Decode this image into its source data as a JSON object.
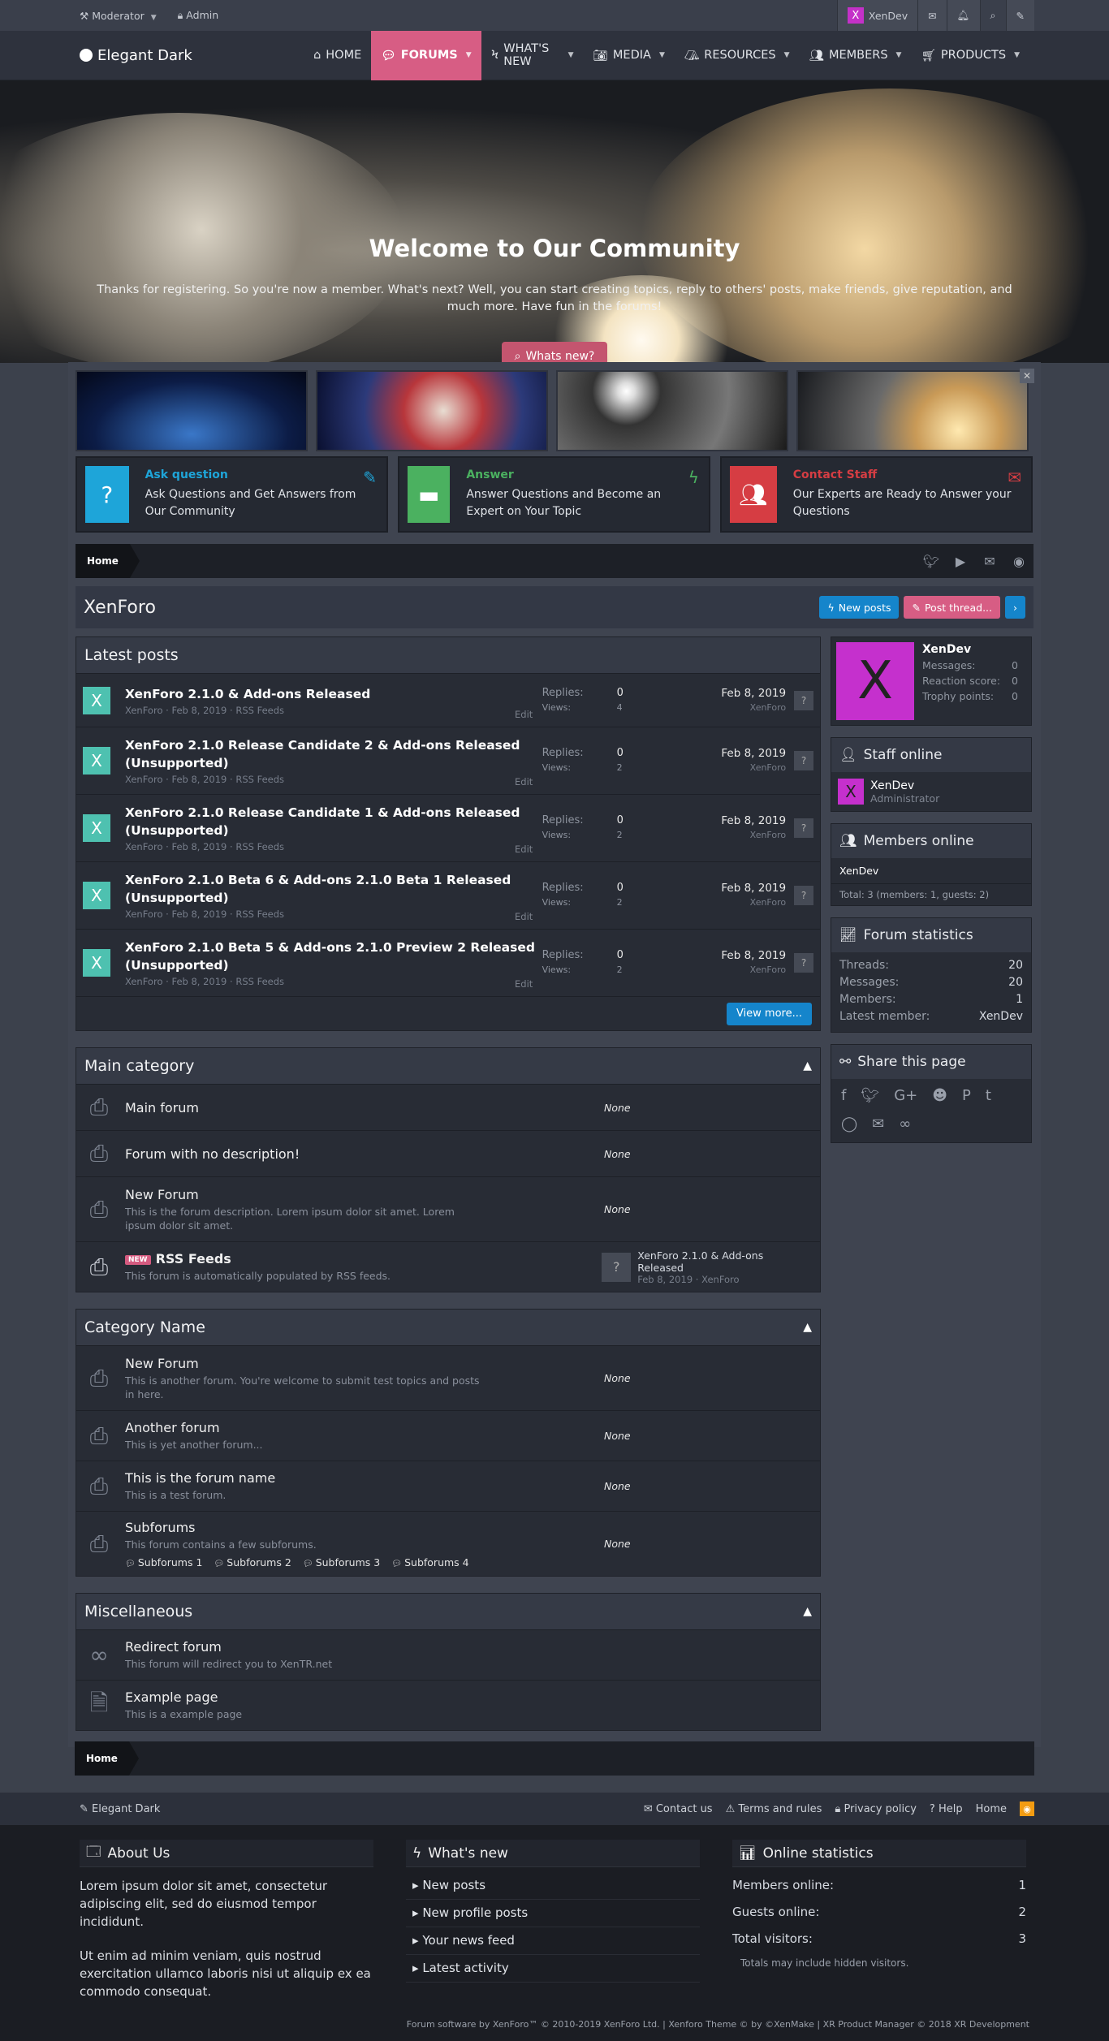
{
  "staffbar": {
    "moderator": "Moderator",
    "admin": "Admin",
    "user": "XenDev",
    "avatar_letter": "X"
  },
  "nav": {
    "logo": "Elegant Dark",
    "tabs": [
      {
        "label": "HOME",
        "icon": "home-icon",
        "caret": false
      },
      {
        "label": "FORUMS",
        "icon": "chat-icon",
        "caret": true
      },
      {
        "label": "WHAT'S NEW",
        "icon": "bolt-icon",
        "caret": true
      },
      {
        "label": "MEDIA",
        "icon": "camera-icon",
        "caret": true
      },
      {
        "label": "RESOURCES",
        "icon": "box-icon",
        "caret": true
      },
      {
        "label": "MEMBERS",
        "icon": "users-icon",
        "caret": true
      },
      {
        "label": "PRODUCTS",
        "icon": "cart-icon",
        "caret": true
      }
    ]
  },
  "hero": {
    "title": "Welcome to Our Community",
    "text": "Thanks for registering. So you're now a member. What's next? Well, you can start creating topics, reply to others' posts, make friends, give reputation, and much more. Have fun in the forums!",
    "button": "Whats new?"
  },
  "features": [
    {
      "title": "Ask question",
      "text": "Ask Questions and Get Answers from Our Community",
      "color": "#1ea5d9",
      "icon": "question-icon",
      "corner": "edit-icon",
      "corner_glyph": "✎"
    },
    {
      "title": "Answer",
      "text": "Answer Questions and Become an Expert on Your Topic",
      "color": "#4bb160",
      "icon": "comment-icon",
      "corner": "bolt-icon",
      "corner_glyph": "ϟ"
    },
    {
      "title": "Contact Staff",
      "text": "Our Experts are Ready to Answer your Questions",
      "color": "#d63d43",
      "icon": "users-icon",
      "corner": "mail-icon",
      "corner_glyph": "✉"
    }
  ],
  "breadcrumb": {
    "home": "Home"
  },
  "title": {
    "text": "XenForo",
    "new_posts": "New posts",
    "post_thread": "Post thread..."
  },
  "latest": {
    "title": "Latest posts",
    "replies_label": "Replies:",
    "views_label": "Views:",
    "edit_label": "Edit",
    "view_more": "View more...",
    "posts": [
      {
        "title": "XenForo 2.1.0 & Add-ons Released",
        "author": "XenForo",
        "date": "Feb 8, 2019",
        "forum": "RSS Feeds",
        "replies": "0",
        "views": "4",
        "last_date": "Feb 8, 2019",
        "last_user": "XenForo"
      },
      {
        "title": "XenForo 2.1.0 Release Candidate 2 & Add-ons Released (Unsupported)",
        "author": "XenForo",
        "date": "Feb 8, 2019",
        "forum": "RSS Feeds",
        "replies": "0",
        "views": "2",
        "last_date": "Feb 8, 2019",
        "last_user": "XenForo"
      },
      {
        "title": "XenForo 2.1.0 Release Candidate 1 & Add-ons Released (Unsupported)",
        "author": "XenForo",
        "date": "Feb 8, 2019",
        "forum": "RSS Feeds",
        "replies": "0",
        "views": "2",
        "last_date": "Feb 8, 2019",
        "last_user": "XenForo"
      },
      {
        "title": "XenForo 2.1.0 Beta 6 & Add-ons 2.1.0 Beta 1 Released (Unsupported)",
        "author": "XenForo",
        "date": "Feb 8, 2019",
        "forum": "RSS Feeds",
        "replies": "0",
        "views": "2",
        "last_date": "Feb 8, 2019",
        "last_user": "XenForo"
      },
      {
        "title": "XenForo 2.1.0 Beta 5 & Add-ons 2.1.0 Preview 2 Released (Unsupported)",
        "author": "XenForo",
        "date": "Feb 8, 2019",
        "forum": "RSS Feeds",
        "replies": "0",
        "views": "2",
        "last_date": "Feb 8, 2019",
        "last_user": "XenForo"
      }
    ]
  },
  "categories": [
    {
      "title": "Main category",
      "forums": [
        {
          "name": "Main forum",
          "desc": "",
          "last": "None"
        },
        {
          "name": "Forum with no description!",
          "desc": "",
          "last": "None"
        },
        {
          "name": "New Forum",
          "desc": "This is the forum description. Lorem ipsum dolor sit amet. Lorem ipsum dolor sit amet.",
          "last": "None"
        },
        {
          "name": "RSS Feeds",
          "desc": "This forum is automatically populated by RSS feeds.",
          "badge": "NEW",
          "last_title": "XenForo 2.1.0 & Add-ons Released",
          "last_meta": "Feb 8, 2019 · XenForo"
        }
      ]
    },
    {
      "title": "Category Name",
      "forums": [
        {
          "name": "New Forum",
          "desc": "This is another forum. You're welcome to submit test topics and posts in here.",
          "last": "None"
        },
        {
          "name": "Another forum",
          "desc": "This is yet another forum...",
          "last": "None"
        },
        {
          "name": "This is the forum name",
          "desc": "This is a test forum.",
          "last": "None"
        },
        {
          "name": "Subforums",
          "desc": "This forum contains a few subforums.",
          "last": "None",
          "subs": [
            "Subforums 1",
            "Subforums 2",
            "Subforums 3",
            "Subforums 4"
          ]
        }
      ]
    },
    {
      "title": "Miscellaneous",
      "forums": [
        {
          "name": "Redirect forum",
          "desc": "This forum will redirect you to XenTR.net",
          "icon": "link-icon"
        },
        {
          "name": "Example page",
          "desc": "This is a example page",
          "icon": "page-icon"
        }
      ]
    }
  ],
  "sidebar": {
    "user": {
      "name": "XenDev",
      "letter": "X",
      "messages_label": "Messages:",
      "messages": "0",
      "reaction_label": "Reaction score:",
      "reaction": "0",
      "trophy_label": "Trophy points:",
      "trophy": "0"
    },
    "staff": {
      "title": "Staff online",
      "name": "XenDev",
      "role": "Administrator"
    },
    "members": {
      "title": "Members online",
      "name": "XenDev",
      "total": "Total: 3 (members: 1, guests: 2)"
    },
    "stats": {
      "title": "Forum statistics",
      "threads_label": "Threads:",
      "threads": "20",
      "messages_label": "Messages:",
      "messages": "20",
      "members_label": "Members:",
      "members": "1",
      "latest_label": "Latest member:",
      "latest": "XenDev"
    },
    "share": {
      "title": "Share this page"
    }
  },
  "footer": {
    "style": "Elegant Dark",
    "links": [
      "Contact us",
      "Terms and rules",
      "Privacy policy",
      "Help",
      "Home"
    ],
    "about": {
      "title": "About Us",
      "p1": "Lorem ipsum dolor sit amet, consectetur adipiscing elit, sed do eiusmod tempor incididunt.",
      "p2": "Ut enim ad minim veniam, quis nostrud exercitation ullamco laboris nisi ut aliquip ex ea commodo consequat."
    },
    "whatsnew": {
      "title": "What's new",
      "items": [
        "New posts",
        "New profile posts",
        "Your news feed",
        "Latest activity"
      ]
    },
    "online": {
      "title": "Online statistics",
      "members_label": "Members online:",
      "members": "1",
      "guests_label": "Guests online:",
      "guests": "2",
      "total_label": "Total visitors:",
      "total": "3",
      "note": "Totals may include hidden visitors."
    },
    "copyright": "Forum software by XenForo™ © 2010-2019 XenForo Ltd. | Xenforo Theme © by ©XenMake | XR Product Manager © 2018 XR Development"
  },
  "colors": {
    "accent": "#d75d84",
    "blue": "#1585cb",
    "teal": "#4ec1b0",
    "purple": "#c530cd"
  }
}
